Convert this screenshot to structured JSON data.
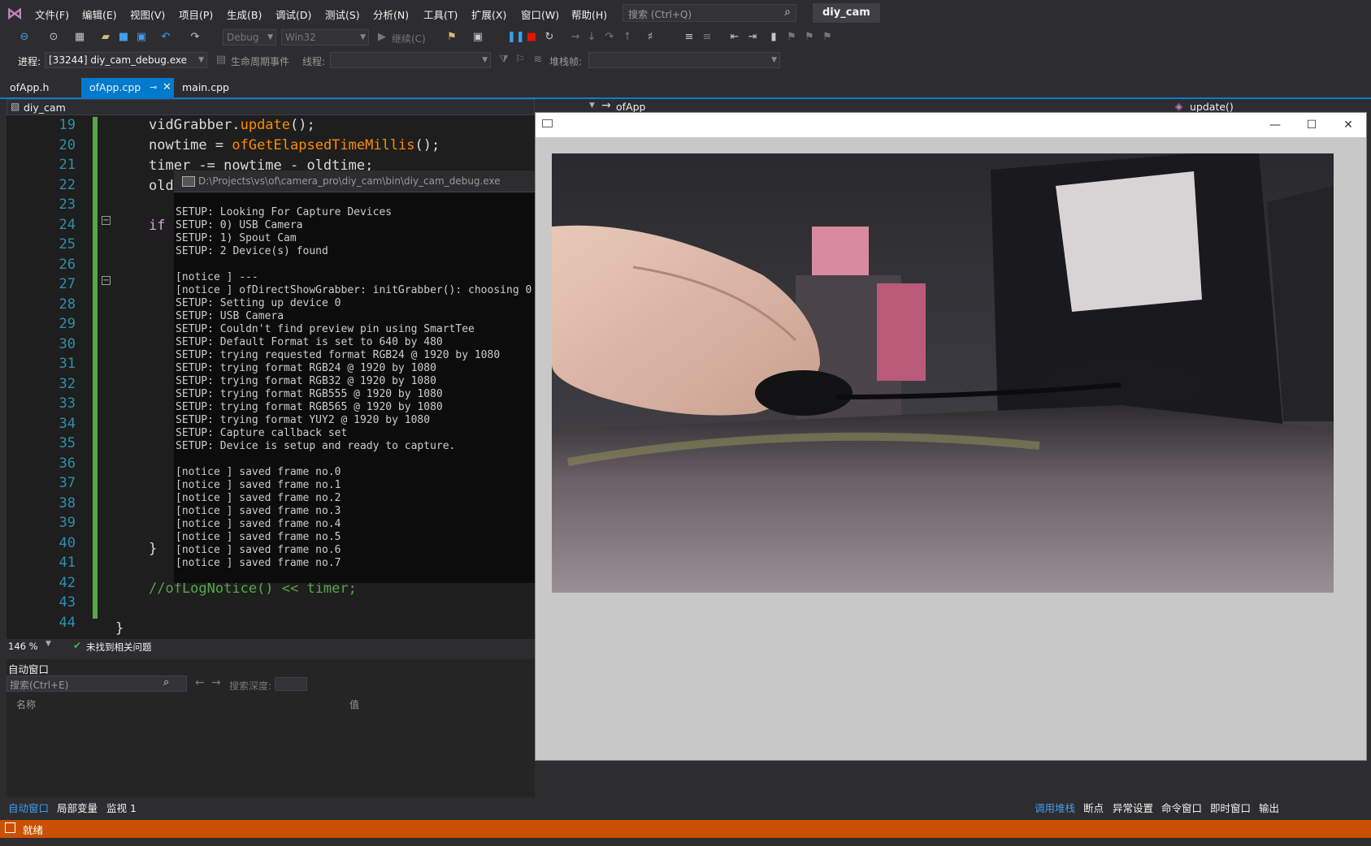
{
  "menubar": {
    "items": [
      "文件(F)",
      "编辑(E)",
      "视图(V)",
      "项目(P)",
      "生成(B)",
      "调试(D)",
      "测试(S)",
      "分析(N)",
      "工具(T)",
      "扩展(X)",
      "窗口(W)",
      "帮助(H)"
    ],
    "search_placeholder": "搜索 (Ctrl+Q)",
    "solution_name": "diy_cam"
  },
  "toolbar": {
    "config": "Debug",
    "platform": "Win32",
    "continue_label": "继续(C)",
    "process_label": "进程:",
    "process_value": "[33244] diy_cam_debug.exe",
    "lifecycle_label": "生命周期事件",
    "thread_label": "线程:",
    "stackframe_label": "堆栈帧:"
  },
  "doc_tabs": [
    {
      "label": "ofApp.h",
      "active": false
    },
    {
      "label": "ofApp.cpp",
      "active": true
    },
    {
      "label": "main.cpp",
      "active": false
    }
  ],
  "navbar": {
    "project": "diy_cam",
    "class": "ofApp",
    "member": "update()"
  },
  "editor": {
    "line_numbers": [
      "19",
      "20",
      "21",
      "22",
      "23",
      "24",
      "25",
      "26",
      "27",
      "28",
      "29",
      "30",
      "31",
      "32",
      "33",
      "34",
      "35",
      "36",
      "37",
      "38",
      "39",
      "40",
      "41",
      "42",
      "43",
      "44"
    ],
    "code": {
      "l19a": "vidGrabber.",
      "l19b": "update",
      "l19c": "();",
      "l20a": "nowtime = ",
      "l20b": "ofGetElapsedTimeMillis",
      "l20c": "();",
      "l21": "timer -= nowtime - oldtime;",
      "l22": "old",
      "l24": "if",
      "l40": "}",
      "l42": "//ofLogNotice() << timer;",
      "l44": "}"
    }
  },
  "console": {
    "title": "D:\\Projects\\vs\\of\\camera_pro\\diy_cam\\bin\\diy_cam_debug.exe",
    "lines": [
      "SETUP: Looking For Capture Devices",
      "SETUP: 0) USB Camera",
      "SETUP: 1) Spout Cam",
      "SETUP: 2 Device(s) found",
      "",
      "[notice ] ---",
      "[notice ] ofDirectShowGrabber: initGrabber(): choosing 0",
      "SETUP: Setting up device 0",
      "SETUP: USB Camera",
      "SETUP: Couldn't find preview pin using SmartTee",
      "SETUP: Default Format is set to 640 by 480",
      "SETUP: trying requested format RGB24 @ 1920 by 1080",
      "SETUP: trying format RGB24 @ 1920 by 1080",
      "SETUP: trying format RGB32 @ 1920 by 1080",
      "SETUP: trying format RGB555 @ 1920 by 1080",
      "SETUP: trying format RGB565 @ 1920 by 1080",
      "SETUP: trying format YUY2 @ 1920 by 1080",
      "SETUP: Capture callback set",
      "SETUP: Device is setup and ready to capture.",
      "",
      "[notice ] saved frame no.0",
      "[notice ] saved frame no.1",
      "[notice ] saved frame no.2",
      "[notice ] saved frame no.3",
      "[notice ] saved frame no.4",
      "[notice ] saved frame no.5",
      "[notice ] saved frame no.6",
      "[notice ] saved frame no.7"
    ]
  },
  "editor_status": {
    "zoom": "146 %",
    "issues": "未找到相关问题"
  },
  "autos": {
    "title": "自动窗口",
    "search_placeholder": "搜索(Ctrl+E)",
    "depth_label": "搜索深度:",
    "col_name": "名称",
    "col_value": "值"
  },
  "bottom_tabs_left": [
    {
      "label": "自动窗口",
      "active": true
    },
    {
      "label": "局部变量",
      "active": false
    },
    {
      "label": "监视 1",
      "active": false
    }
  ],
  "bottom_tabs_right": [
    {
      "label": "调用堆栈",
      "active": true
    },
    {
      "label": "断点",
      "active": false
    },
    {
      "label": "异常设置",
      "active": false
    },
    {
      "label": "命令窗口",
      "active": false
    },
    {
      "label": "即时窗口",
      "active": false
    },
    {
      "label": "输出",
      "active": false
    }
  ],
  "statusbar": {
    "text": "就绪"
  },
  "colors": {
    "accent": "#007acc",
    "status_debug": "#ca5100",
    "code_keyword": "#d8a0df",
    "code_function": "#ff8c00",
    "code_comment": "#57a64a",
    "line_number": "#2b91af"
  }
}
